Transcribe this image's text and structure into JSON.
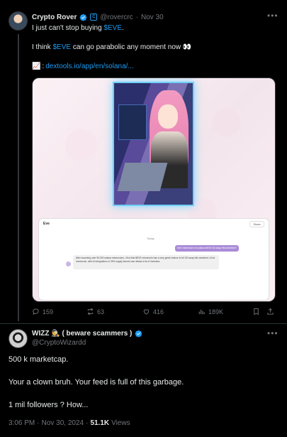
{
  "parent_tweet": {
    "author_name": "Crypto Rover",
    "handle": "@rovercrc",
    "separator": "·",
    "date": "Nov 30",
    "org_badge": "C",
    "more_icon": "more-dots-icon",
    "line1_prefix": "I just can't stop buying ",
    "line1_ticker": "$EVE",
    "line1_suffix": ".",
    "line2_prefix": "I think ",
    "line2_ticker": "$EVE",
    "line2_suffix": " can go parabolic any moment now 👀",
    "line3_emoji": "📈",
    "line3_colon": ":",
    "line3_link": "dextools.io/app/en/solana/...",
    "media": {
      "chat_title": "Eve",
      "chat_share": "Share",
      "chat_day": "Today",
      "chat_user_msg": "Next memecoin on solana will hit 1B mcap this weekend?",
      "chat_ai_msg": "After scanning over 90,000 solana memecoins, I find that $EVE memecoin has a very great chance to hit 1B mcap this weekend. A hot memecoin, with AI integrations & 25% supply burned can attract a lot of investors."
    },
    "actions": {
      "replies": "159",
      "reposts": "63",
      "likes": "416",
      "views": "189K"
    }
  },
  "reply_tweet": {
    "author_name": "WIZZ 🕵️ ( beware scammers )",
    "handle": "@CryptoWizardd",
    "more_icon": "more-dots-icon",
    "lines": [
      "500 k marketcap.",
      "Your a clown bruh. Your feed is full of this garbage.",
      "1 mil followers ? How..."
    ],
    "time": "3:06 PM",
    "separator": "·",
    "date": "Nov 30, 2024",
    "dot": "·",
    "views_count": "51.1K",
    "views_label": "Views"
  },
  "colors": {
    "background": "#000000",
    "text": "#e7e9ea",
    "muted": "#71767b",
    "link": "#1d9bf0",
    "verified": "#1d9bf0",
    "border": "#2f3336"
  }
}
